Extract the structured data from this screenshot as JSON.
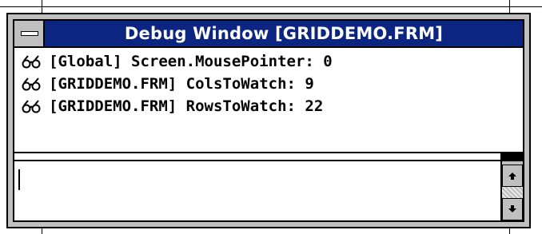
{
  "window": {
    "title": "Debug Window [GRIDDEMO.FRM]"
  },
  "watches": [
    {
      "icon": "glasses-icon",
      "text": "[Global] Screen.MousePointer: 0"
    },
    {
      "icon": "glasses-icon",
      "text": "[GRIDDEMO.FRM] ColsToWatch: 9"
    },
    {
      "icon": "glasses-icon",
      "text": "[GRIDDEMO.FRM] RowsToWatch: 22"
    }
  ],
  "immediate": {
    "value": ""
  },
  "scrollbar": {
    "up_icon": "up-arrow-icon",
    "down_icon": "down-arrow-icon"
  },
  "colors": {
    "titlebar": "#0b2580",
    "frame": "#c0c0c0"
  }
}
